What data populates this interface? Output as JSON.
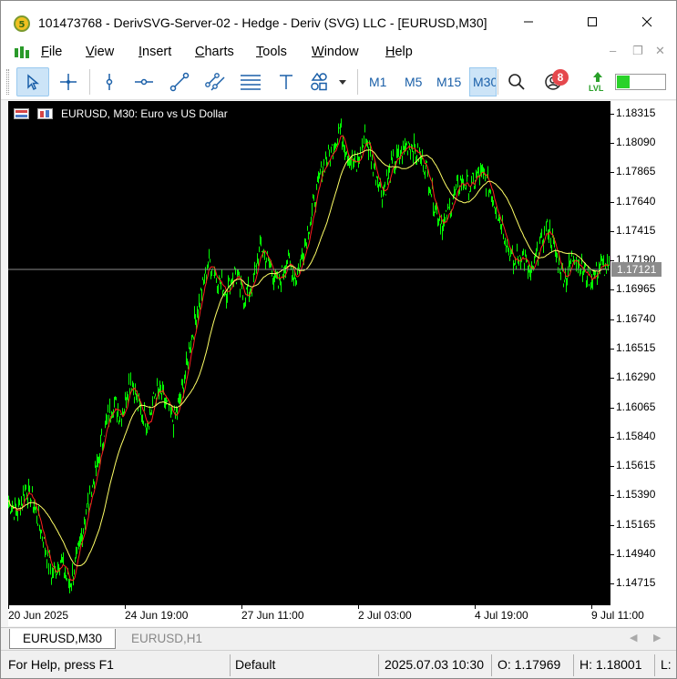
{
  "window": {
    "title": "101473768 - DerivSVG-Server-02 - Hedge - Deriv (SVG) LLC - [EURUSD,M30]"
  },
  "menu": [
    {
      "label": "File",
      "mnemonic": "F",
      "rest": "ile"
    },
    {
      "label": "View",
      "mnemonic": "V",
      "rest": "iew"
    },
    {
      "label": "Insert",
      "mnemonic": "I",
      "rest": "nsert"
    },
    {
      "label": "Charts",
      "mnemonic": "C",
      "rest": "harts"
    },
    {
      "label": "Tools",
      "mnemonic": "T",
      "rest": "ools"
    },
    {
      "label": "Window",
      "mnemonic": "W",
      "rest": "indow"
    },
    {
      "label": "Help",
      "mnemonic": "H",
      "rest": "elp"
    }
  ],
  "toolbar": {
    "tools": [
      "cursor-icon",
      "crosshair-icon",
      "vertical-line-icon",
      "horizontal-line-icon",
      "trendline-icon",
      "channel-icon",
      "fibonacci-icon",
      "text-icon",
      "shapes-icon"
    ],
    "timeframes": [
      "M1",
      "M5",
      "M15",
      "M30"
    ],
    "active_timeframe": "M30",
    "notification_count": "8",
    "level_label": "LVL",
    "accent": "#1a5fa8"
  },
  "chart": {
    "label": "EURUSD, M30:  Euro vs US Dollar",
    "current_price": "1.17121",
    "candle_color": "#00ff00",
    "ma_fast_color": "#ff2020",
    "ma_slow_color": "#ffff66"
  },
  "chart_data": {
    "type": "line",
    "title": "EURUSD, M30:  Euro vs US Dollar",
    "xlabel": "",
    "ylabel": "",
    "x_tick_labels": [
      "20 Jun 2025",
      "24 Jun 19:00",
      "27 Jun 11:00",
      "2 Jul 03:00",
      "4 Jul 19:00",
      "9 Jul 11:00"
    ],
    "y_tick_labels": [
      "1.18315",
      "1.18090",
      "1.17865",
      "1.17640",
      "1.17415",
      "1.17190",
      "1.16965",
      "1.16740",
      "1.16515",
      "1.16290",
      "1.16065",
      "1.15840",
      "1.15615",
      "1.15390",
      "1.15165",
      "1.14940",
      "1.14715"
    ],
    "ylim": [
      1.1455,
      1.1841
    ],
    "current_price": 1.17121,
    "grid": false,
    "series": [
      {
        "values": [
          1.1535,
          1.1525,
          1.1545,
          1.153,
          1.1505,
          1.1478,
          1.149,
          1.147,
          1.1495,
          1.153,
          1.1555,
          1.159,
          1.161,
          1.16,
          1.163,
          1.1605,
          1.1595,
          1.162,
          1.161,
          1.1595,
          1.162,
          1.166,
          1.169,
          1.172,
          1.1705,
          1.1695,
          1.171,
          1.169,
          1.17,
          1.173,
          1.1715,
          1.17,
          1.172,
          1.1705,
          1.173,
          1.176,
          1.179,
          1.18,
          1.182,
          1.18,
          1.179,
          1.1815,
          1.179,
          1.177,
          1.179,
          1.18,
          1.181,
          1.18,
          1.179,
          1.176,
          1.1745,
          1.1765,
          1.178,
          1.1775,
          1.1785,
          1.178,
          1.176,
          1.174,
          1.1715,
          1.1725,
          1.1705,
          1.173,
          1.1745,
          1.172,
          1.1705,
          1.1725,
          1.171,
          1.1705,
          1.1715,
          1.1712
        ]
      }
    ]
  },
  "tabs": [
    {
      "label": "EURUSD,M30",
      "active": true
    },
    {
      "label": "EURUSD,H1",
      "active": false
    }
  ],
  "status": {
    "help": "For Help, press F1",
    "profile": "Default",
    "datetime": "2025.07.03 10:30",
    "open": "O: 1.17969",
    "high": "H: 1.18001",
    "more": "L:"
  }
}
